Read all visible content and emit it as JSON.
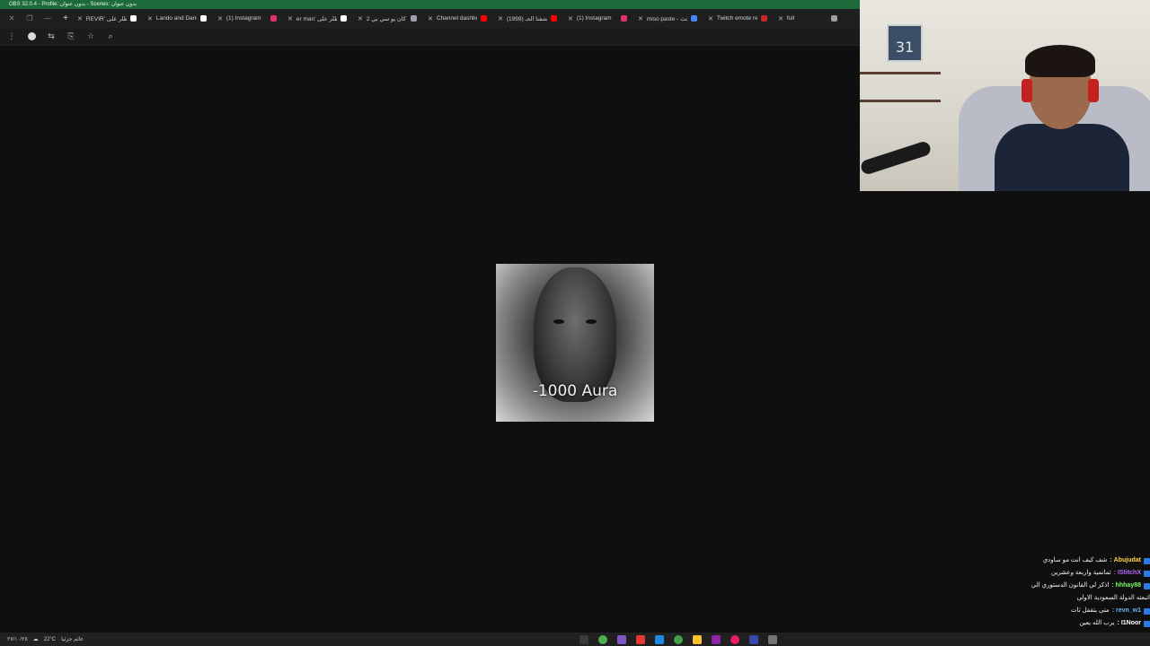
{
  "window": {
    "title": "OBS 32.0.4 - Profile: بدون عنوان - Scenes: بدون عنوان"
  },
  "browser": {
    "tabs": [
      {
        "label": "REVIR' اطلر على",
        "favicon": "tiktok-icon",
        "color": "#ffffff"
      },
      {
        "label": "Lando and Danie",
        "favicon": "tiktok-icon",
        "color": "#ffffff"
      },
      {
        "label": "(1) Instagram",
        "favicon": "instagram-icon",
        "color": "#e1306c"
      },
      {
        "label": "er man' اطلر على",
        "favicon": "tiktok-icon",
        "color": "#ffffff"
      },
      {
        "label": "كان يو سي بي 2",
        "favicon": "globe-icon",
        "color": "#9aa0a6"
      },
      {
        "label": "Channel dashbo",
        "favicon": "youtube-icon",
        "color": "#ff0000"
      },
      {
        "label": "(1999) كشفنا الحـ",
        "favicon": "youtube-icon",
        "color": "#ff0000"
      },
      {
        "label": "(1) Instagram",
        "favicon": "instagram-icon",
        "color": "#e1306c"
      },
      {
        "label": "miso paste - بحث",
        "favicon": "google-icon",
        "color": "#4285f4"
      },
      {
        "label": "Twitch emote re",
        "favicon": "shield-icon",
        "color": "#c62828"
      },
      {
        "label": "full",
        "favicon": "page-icon",
        "color": "#9aa0a6"
      }
    ]
  },
  "emote": {
    "caption": "-1000 Aura"
  },
  "webcam": {
    "frame_number": "31"
  },
  "chat": {
    "messages": [
      {
        "user": "Abujudat",
        "text": "شف كيف انت مو ساودي",
        "user_color": "#ffd54a"
      },
      {
        "user": "IStitchX",
        "text": "ثمانمية واربعة وعشرين",
        "user_color": "#b36bff"
      },
      {
        "user": "hhhay88",
        "text": "اذكر لي القانون الدستوري الي",
        "user_color": "#7cfc6b"
      },
      {
        "user": "",
        "text": "اتبعته الدولة السعودية الاولى",
        "user_color": "#ffffff"
      },
      {
        "user": "revn_w1",
        "text": "متى يتقفل ثات",
        "user_color": "#6bb7ff"
      },
      {
        "user": "I1Noor",
        "text": "يرب الله يعين",
        "user_color": "#ffffff"
      }
    ]
  },
  "taskbar": {
    "temperature": "22°C",
    "weather": "غائم جزئيا",
    "date": "٢٧/١٠/٢٥"
  }
}
